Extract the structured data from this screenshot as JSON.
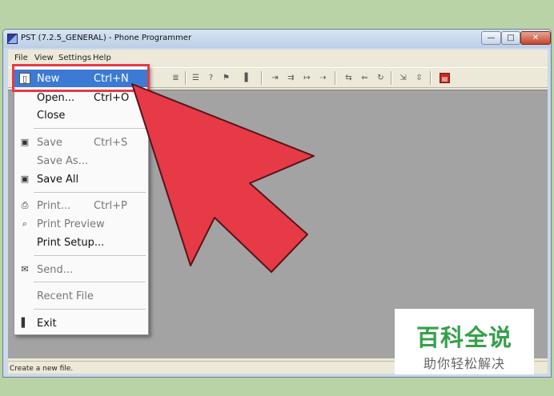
{
  "window": {
    "title": "PST (7.2.5_GENERAL) - Phone Programmer",
    "minimize_glyph": "—",
    "maximize_glyph": "□",
    "close_glyph": "✕"
  },
  "menubar": {
    "items": [
      "File",
      "View",
      "Settings",
      "Help"
    ]
  },
  "toolbar": {
    "icons": [
      "binoculars-icon",
      "print-icon",
      "help-icon",
      "context-help-icon",
      "phone-icon",
      "tool-icon-1",
      "tool-icon-2",
      "tool-icon-3",
      "tool-icon-4",
      "tool-icon-5",
      "tool-icon-6",
      "tool-icon-7",
      "tool-icon-8",
      "tool-icon-9",
      "database-icon"
    ],
    "glyphs": [
      "≣",
      "☰",
      "?",
      "⚑",
      "▌",
      "⇥",
      "⇉",
      "↦",
      "⇢",
      "⇆",
      "⇐",
      "↻",
      "⇲",
      "⇳",
      "▤"
    ]
  },
  "file_menu": {
    "items": [
      {
        "label": "New",
        "shortcut": "Ctrl+N",
        "icon": "new-document-icon",
        "glyph": "▯",
        "state": "highlighted"
      },
      {
        "label": "Open...",
        "shortcut": "Ctrl+O",
        "icon": "",
        "glyph": "",
        "state": "normal"
      },
      {
        "label": "Close",
        "shortcut": "",
        "icon": "",
        "glyph": "",
        "state": "normal"
      },
      {
        "label": "Save",
        "shortcut": "Ctrl+S",
        "icon": "save-icon",
        "glyph": "▣",
        "state": "disabled"
      },
      {
        "label": "Save As...",
        "shortcut": "",
        "icon": "",
        "glyph": "",
        "state": "disabled"
      },
      {
        "label": "Save All",
        "shortcut": "",
        "icon": "save-all-icon",
        "glyph": "▣",
        "state": "normal"
      },
      {
        "label": "Print...",
        "shortcut": "Ctrl+P",
        "icon": "print-icon",
        "glyph": "⎙",
        "state": "disabled"
      },
      {
        "label": "Print Preview",
        "shortcut": "",
        "icon": "print-preview-icon",
        "glyph": "⌕",
        "state": "disabled"
      },
      {
        "label": "Print Setup...",
        "shortcut": "",
        "icon": "",
        "glyph": "",
        "state": "normal"
      },
      {
        "label": "Send...",
        "shortcut": "",
        "icon": "mail-icon",
        "glyph": "✉",
        "state": "disabled"
      },
      {
        "label": "Recent File",
        "shortcut": "",
        "icon": "",
        "glyph": "",
        "state": "disabled"
      },
      {
        "label": "Exit",
        "shortcut": "",
        "icon": "exit-icon",
        "glyph": "▌",
        "state": "normal"
      }
    ]
  },
  "status": {
    "text": "Create a new file."
  },
  "watermark": {
    "title": "百科全说",
    "subtitle": "助你轻松解决"
  },
  "colors": {
    "background": "#b9d3a6",
    "highlight": "#3c7bd4",
    "annotation_red": "#e63a47",
    "watermark_green": "#35a04a"
  }
}
